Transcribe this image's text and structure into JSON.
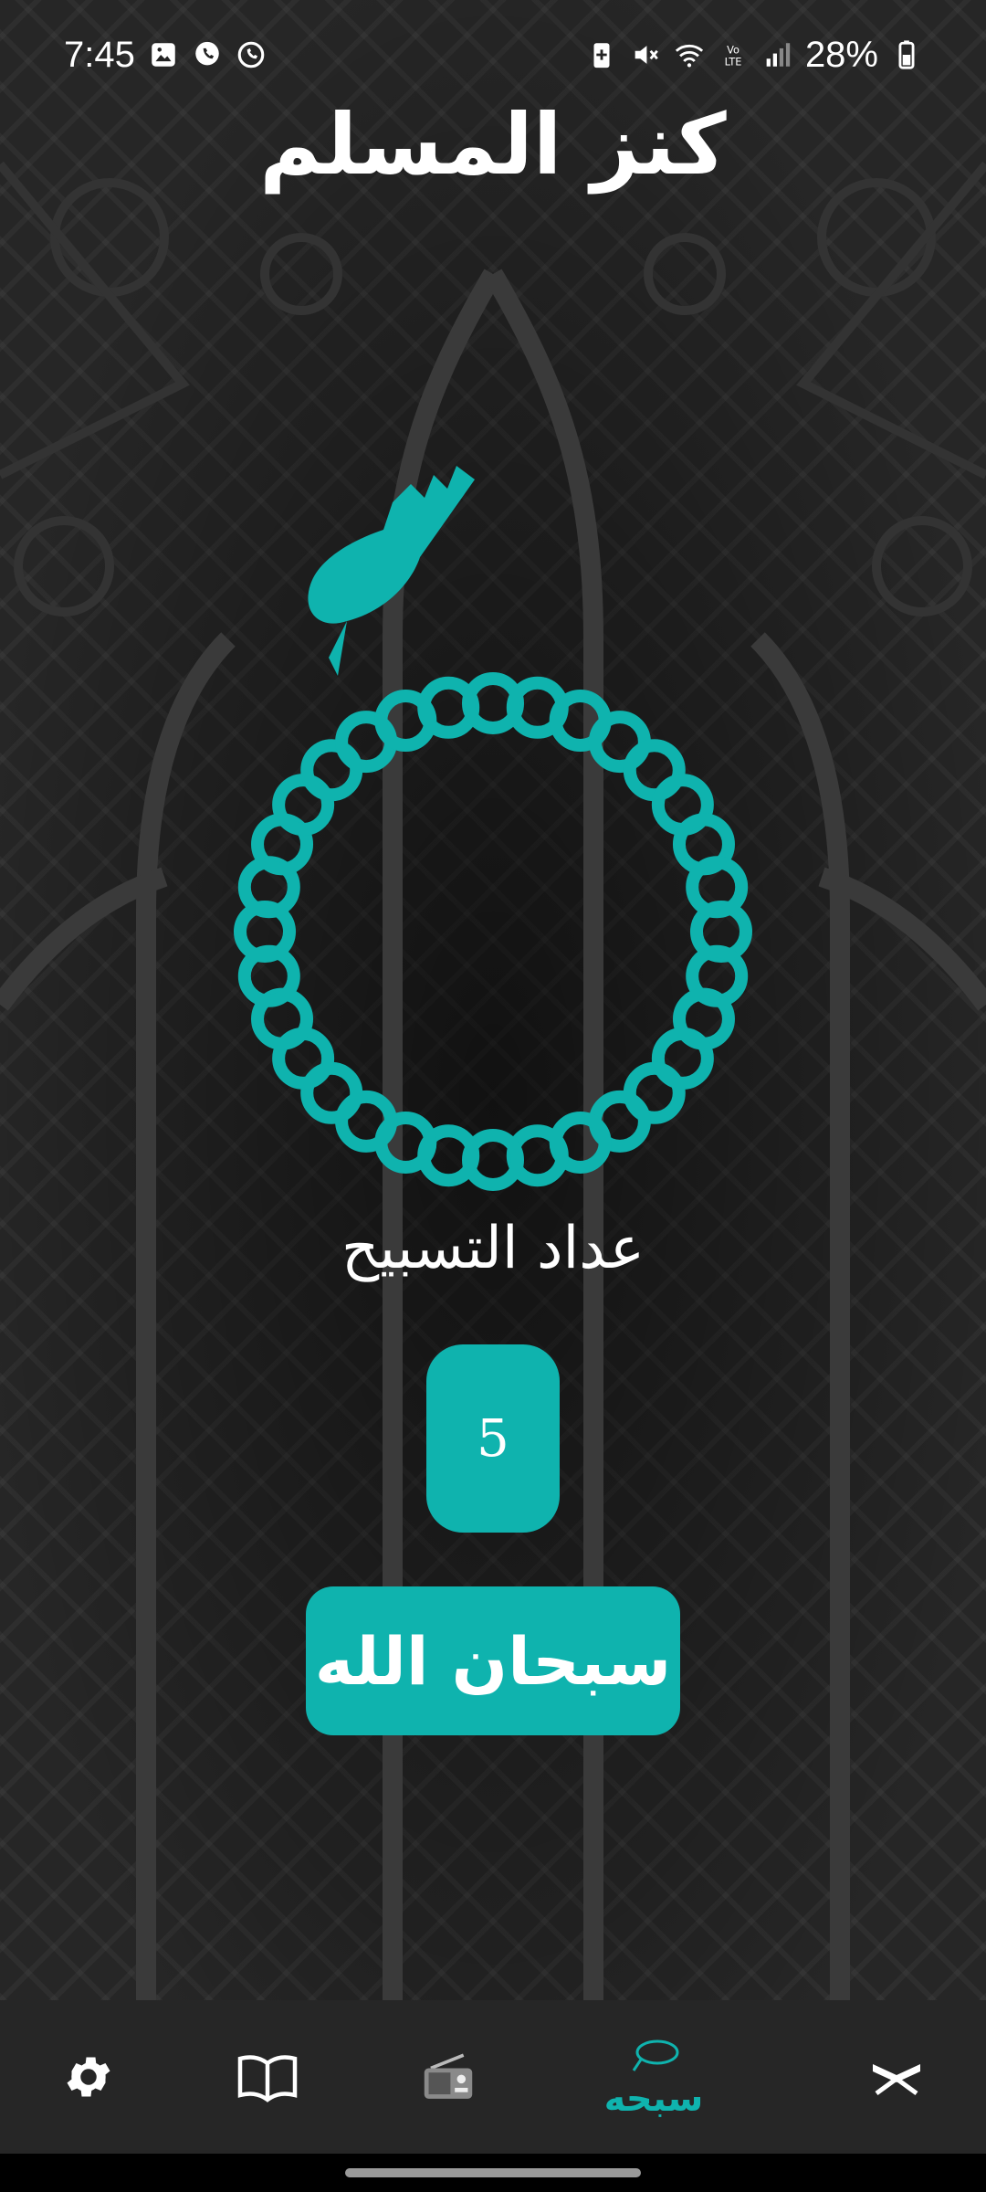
{
  "status_bar": {
    "time": "7:45",
    "battery": "28%",
    "icons": [
      "gallery-icon",
      "viber-icon",
      "whatsapp-icon",
      "battery-saver-icon",
      "mute-icon",
      "wifi-icon",
      "volte-icon",
      "signal-icon",
      "battery-icon"
    ]
  },
  "app": {
    "title": "كنز المسلم"
  },
  "counter": {
    "title": "عداد التسبيح",
    "count": "5",
    "tasbih_label": "سبحان الله"
  },
  "nav": {
    "items": [
      {
        "id": "settings",
        "icon": "gear-icon",
        "label": ""
      },
      {
        "id": "book",
        "icon": "book-icon",
        "label": ""
      },
      {
        "id": "radio",
        "icon": "radio-icon",
        "label": ""
      },
      {
        "id": "tasbih",
        "icon": "prayer-beads-icon",
        "label": "سبحه",
        "active": true
      },
      {
        "id": "quran",
        "icon": "quran-stand-icon",
        "label": ""
      }
    ]
  },
  "colors": {
    "accent": "#0fb3ae",
    "background": "#262626",
    "text": "#ffffff"
  }
}
